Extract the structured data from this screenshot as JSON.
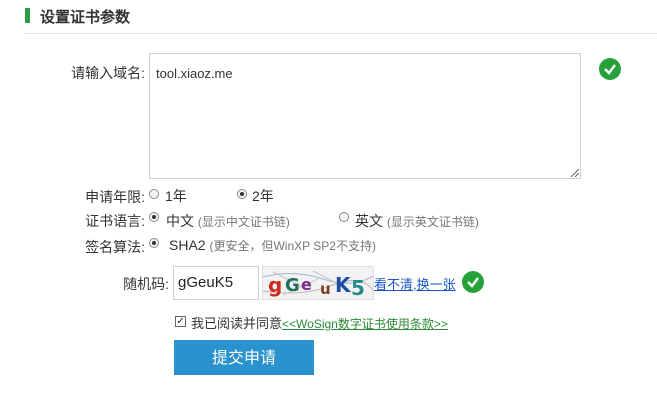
{
  "section": {
    "title": "设置证书参数"
  },
  "domain": {
    "label": "请输入域名:",
    "value": "tool.xiaoz.me"
  },
  "years": {
    "label": "申请年限:",
    "options": [
      {
        "label": "1年",
        "checked": false
      },
      {
        "label": "2年",
        "checked": true
      }
    ]
  },
  "language": {
    "label": "证书语言:",
    "options": [
      {
        "label": "中文",
        "hint": "(显示中文证书链)",
        "checked": true
      },
      {
        "label": "英文",
        "hint": "(显示英文证书链)",
        "checked": false
      }
    ]
  },
  "algorithm": {
    "label": "签名算法:",
    "option": "SHA2",
    "hint": "(更安全，但WinXP SP2不支持)",
    "checked": true
  },
  "captcha": {
    "label": "随机码:",
    "value": "gGeuK5",
    "image_text": "gGeuK5",
    "refresh": "看不清,换一张"
  },
  "agreement": {
    "text": "我已阅读并同意",
    "link": "<<WoSign数字证书使用条款>>",
    "checked": true
  },
  "submit_label": "提交申请",
  "colors": {
    "success": "#27a13a",
    "submit": "#2a93cf",
    "accent": "#2e9b4a",
    "link": "#1a56c4"
  }
}
